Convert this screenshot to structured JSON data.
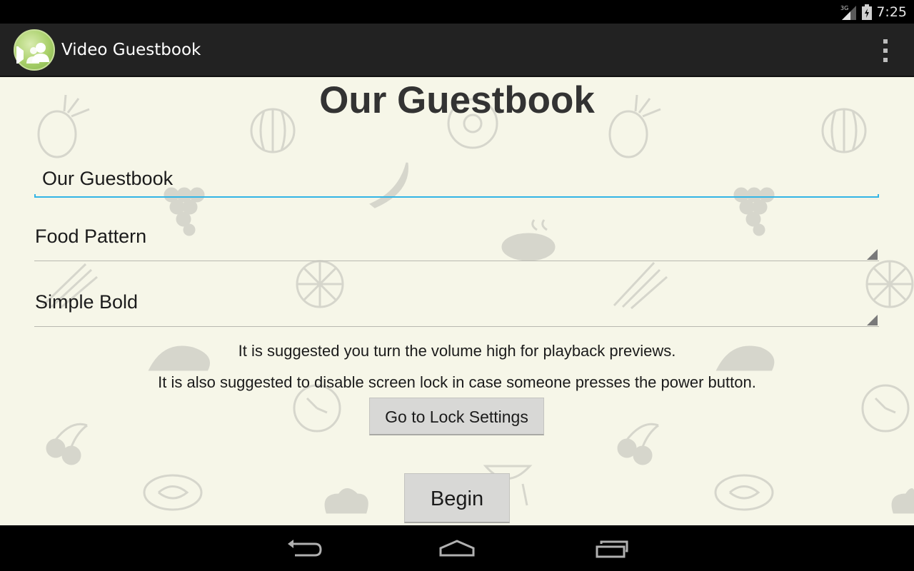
{
  "status_bar": {
    "network": "3G",
    "time": "7:25"
  },
  "action_bar": {
    "app_title": "Video Guestbook",
    "app_icon": "guestbook-app-icon",
    "overflow_icon": "overflow-menu-icon"
  },
  "main": {
    "page_title": "Our Guestbook",
    "title_input_value": "Our Guestbook",
    "pattern_spinner_value": "Food Pattern",
    "font_spinner_value": "Simple Bold",
    "hint_volume": "It is suggested you turn the volume high for playback previews.",
    "hint_lock": "It is also suggested to disable screen lock in case someone presses the power button.",
    "lock_settings_label": "Go to Lock Settings",
    "begin_label": "Begin"
  },
  "nav_bar": {
    "back_icon": "back-icon",
    "home_icon": "home-icon",
    "recents_icon": "recent-apps-icon"
  },
  "colors": {
    "background": "#f6f6e8",
    "action_bar": "#222222",
    "input_accent": "#33b5e5",
    "title_text": "#333333"
  }
}
